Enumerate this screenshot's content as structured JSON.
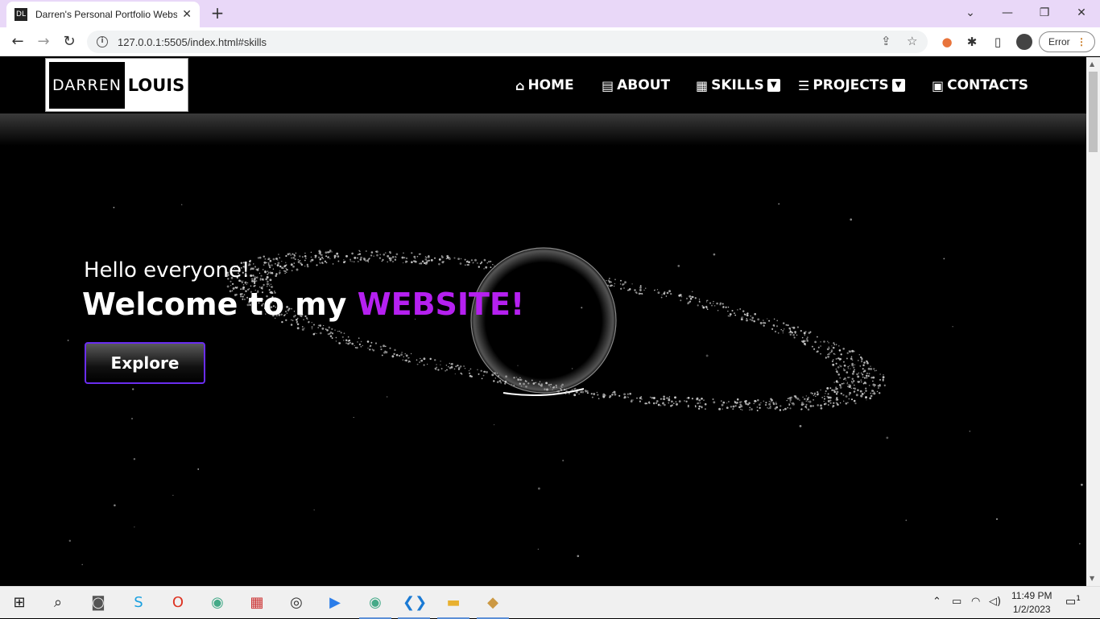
{
  "browser": {
    "tab_title": "Darren's Personal Portfolio Website",
    "url": "127.0.0.1:5505/index.html#skills",
    "profile_button": "Error"
  },
  "site": {
    "logo_left": "DARREN",
    "logo_right": "LOUIS",
    "nav": [
      {
        "label": "HOME",
        "icon": "home-icon"
      },
      {
        "label": "ABOUT",
        "icon": "id-card-icon"
      },
      {
        "label": "SKILLS",
        "icon": "book-icon",
        "dropdown": true
      },
      {
        "label": "PROJECTS",
        "icon": "list-check-icon",
        "dropdown": true
      },
      {
        "label": "CONTACTS",
        "icon": "contact-card-icon"
      }
    ],
    "hero": {
      "greeting": "Hello everyone!",
      "welcome": "Welcome to my",
      "accent": "WEBSITE!",
      "cta": "Explore"
    },
    "colors": {
      "accent": "#b520f0",
      "button_border": "#6a2df0",
      "tab_strip": "#e9d8f8"
    }
  },
  "taskbar": {
    "time": "11:49 PM",
    "date": "1/2/2023",
    "notifications": "1"
  }
}
